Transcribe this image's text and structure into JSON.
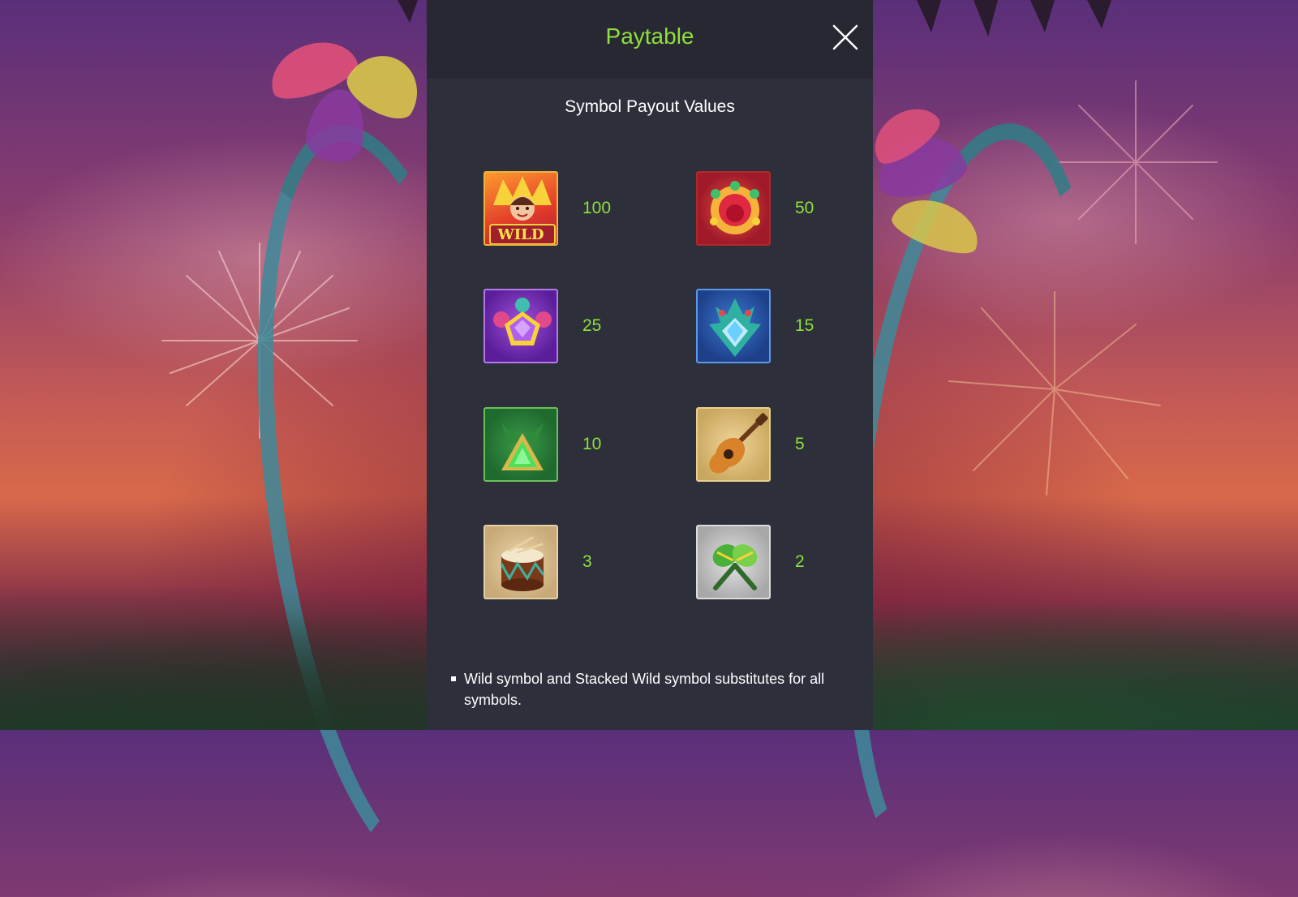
{
  "paytable": {
    "title": "Paytable",
    "section_title": "Symbol Payout Values",
    "symbols": [
      {
        "name": "wild",
        "icon": "wild-dancer-icon",
        "label": "WILD",
        "payout": "100"
      },
      {
        "name": "red-headdress",
        "icon": "red-headdress-icon",
        "payout": "50"
      },
      {
        "name": "purple-gem",
        "icon": "purple-gem-icon",
        "payout": "25"
      },
      {
        "name": "blue-gem",
        "icon": "blue-gem-icon",
        "payout": "15"
      },
      {
        "name": "green-gem",
        "icon": "green-gem-icon",
        "payout": "10"
      },
      {
        "name": "guitar",
        "icon": "guitar-icon",
        "payout": "5"
      },
      {
        "name": "drum",
        "icon": "drum-icon",
        "payout": "3"
      },
      {
        "name": "maracas",
        "icon": "maracas-icon",
        "payout": "2"
      }
    ],
    "note": "Wild symbol and Stacked Wild symbol substitutes for all symbols."
  },
  "colors": {
    "accent": "#8ee03c",
    "panel": "#2d2f3b",
    "header": "#272832"
  }
}
